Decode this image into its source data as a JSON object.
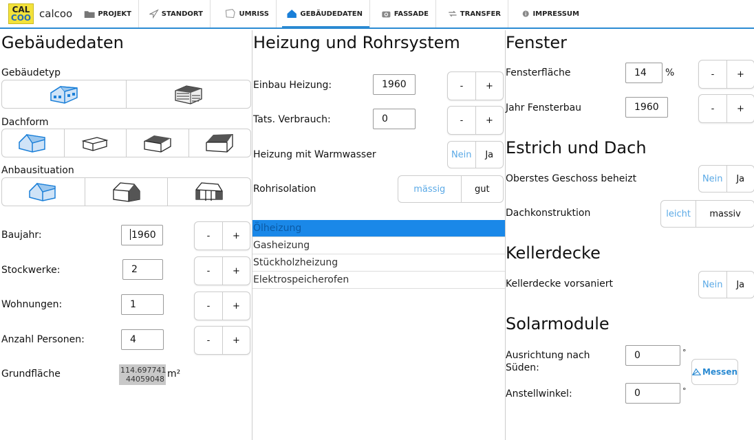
{
  "app": {
    "logo_top": "CAL",
    "logo_bottom": "COO",
    "title": "calcoo"
  },
  "nav": {
    "items": [
      {
        "label": "PROJEKT",
        "icon": "folder-icon"
      },
      {
        "label": "STANDORT",
        "icon": "location-arrow-icon"
      },
      {
        "label": "UMRISS",
        "icon": "outline-icon"
      },
      {
        "label": "GEBÄUDEDATEN",
        "icon": "house-icon"
      },
      {
        "label": "FASSADE",
        "icon": "camera-icon"
      },
      {
        "label": "TRANSFER",
        "icon": "transfer-arrows-icon"
      },
      {
        "label": "IMPRESSUM",
        "icon": "info-icon"
      }
    ],
    "active": "GEBÄUDEDATEN"
  },
  "colors": {
    "accent": "#2a8ad2",
    "selected_row": "#1a88e8",
    "inactive_option": "#5aa9e6",
    "logo_yellow": "#f3e23a"
  },
  "gebaeude": {
    "title": "Gebäudedaten",
    "gebaeudetyp_label": "Gebäudetyp",
    "dachform_label": "Dachform",
    "anbau_label": "Anbausituation",
    "baujahr_label": "Baujahr:",
    "baujahr_value": "1960",
    "stockwerke_label": "Stockwerke:",
    "stockwerke_value": "2",
    "wohnungen_label": "Wohnungen:",
    "wohnungen_value": "1",
    "personen_label": "Anzahl Personen:",
    "personen_value": "4",
    "grundflaeche_label": "Grundfläche",
    "grundflaeche_value_1": "114.697741",
    "grundflaeche_value_2": "44059048",
    "grundflaeche_unit": "m²",
    "minus": "-",
    "plus": "+"
  },
  "heizung": {
    "title": "Heizung und Rohrsystem",
    "einbau_label": "Einbau Heizung:",
    "einbau_value": "1960",
    "verbrauch_label": "Tats. Verbrauch:",
    "verbrauch_value": "0",
    "warmwasser_label": "Heizung mit Warmwasser",
    "warmwasser_no": "Nein",
    "warmwasser_yes": "Ja",
    "rohr_label": "Rohrisolation",
    "rohr_opt1": "mässig",
    "rohr_opt2": "gut",
    "types": [
      "Ölheizung",
      "Gasheizung",
      "Stückholzheizung",
      "Elektrospeicherofen"
    ],
    "selected_type": "Ölheizung"
  },
  "fenster": {
    "title": "Fenster",
    "flaeche_label": "Fensterfläche",
    "flaeche_value": "14",
    "flaeche_unit": "%",
    "jahr_label": "Jahr Fensterbau",
    "jahr_value": "1960"
  },
  "estrich": {
    "title": "Estrich und Dach",
    "geschoss_label": "Oberstes Geschoss beheizt",
    "geschoss_no": "Nein",
    "geschoss_yes": "Ja",
    "dach_label": "Dachkonstruktion",
    "dach_opt1": "leicht",
    "dach_opt2": "massiv"
  },
  "keller": {
    "title": "Kellerdecke",
    "vorsaniert_label": "Kellerdecke vorsaniert",
    "no": "Nein",
    "yes": "Ja"
  },
  "solar": {
    "title": "Solarmodule",
    "ausrichtung_label_1": "Ausrichtung nach",
    "ausrichtung_label_2": "Süden:",
    "ausrichtung_value": "0",
    "anstell_label": "Anstellwinkel:",
    "anstell_value": "0",
    "degree": "°",
    "messen_label": "Messen"
  }
}
